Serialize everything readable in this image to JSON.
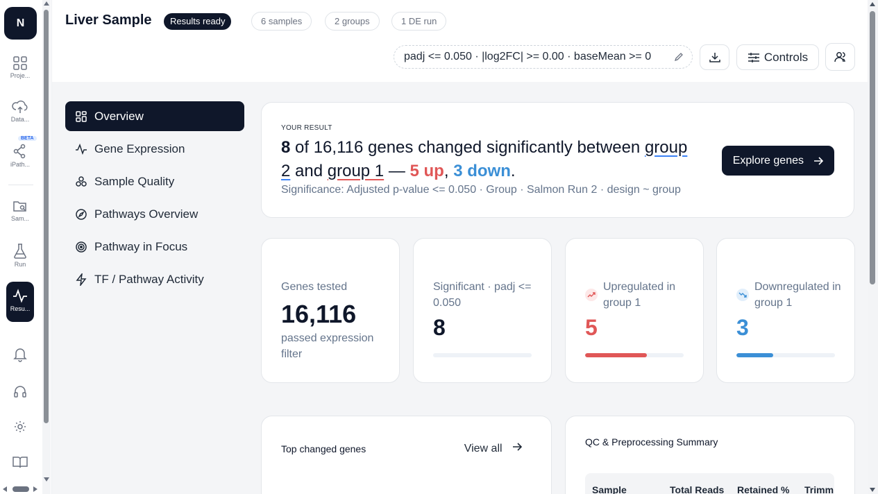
{
  "rail": {
    "logo": "N",
    "beta_badge": "BETA",
    "items": [
      {
        "label": "Proje..."
      },
      {
        "label": "Data..."
      },
      {
        "label": "iPath..."
      },
      {
        "label": "Sam..."
      },
      {
        "label": "Run"
      },
      {
        "label": "Resu..."
      }
    ],
    "bottom_icons": [
      "bell-icon",
      "headset-icon",
      "gear-icon",
      "book-icon"
    ]
  },
  "header": {
    "title": "Liver Sample",
    "status": "Results ready",
    "pills": [
      "6 samples",
      "2 groups",
      "1 DE run"
    ],
    "filter": "padj <= 0.050 · |log2FC| >= 0.00 · baseMean >= 0",
    "controls_label": "Controls"
  },
  "nav": {
    "items": [
      {
        "label": "Overview",
        "icon": "grid-icon"
      },
      {
        "label": "Gene Expression",
        "icon": "pulse-icon"
      },
      {
        "label": "Sample Quality",
        "icon": "cluster-icon"
      },
      {
        "label": "Pathways Overview",
        "icon": "compass-icon"
      },
      {
        "label": "Pathway in Focus",
        "icon": "target-icon"
      },
      {
        "label": "TF / Pathway Activity",
        "icon": "bolt-icon"
      }
    ]
  },
  "result": {
    "eyebrow": "YOUR RESULT",
    "count": "8",
    "text_a": " of 16,116 genes changed significantly between ",
    "group_a": "group 2",
    "text_and": " and ",
    "group_b": "group 1",
    "text_dash": " — ",
    "up": "5 up",
    "comma": ", ",
    "down": "3 down",
    "period": ".",
    "significance": "Significance: Adjusted p-value <= 0.050 · Group · Salmon Run 2 · design ~ group",
    "explore_label": "Explore genes"
  },
  "stats": {
    "tested": {
      "label": "Genes tested",
      "value": "16,116",
      "sub": "passed expression filter"
    },
    "significant": {
      "label": "Significant · padj <= 0.050",
      "value": "8",
      "fraction": 0
    },
    "up": {
      "label": "Upregulated in group 1",
      "value": "5",
      "fraction": 0.625,
      "color": "#e05757"
    },
    "down": {
      "label": "Downregulated in group 1",
      "value": "3",
      "fraction": 0.375,
      "color": "#3b8fd6"
    }
  },
  "top_genes": {
    "title": "Top changed genes",
    "view_all": "View all"
  },
  "qc": {
    "title": "QC & Preprocessing Summary",
    "columns": [
      "Sample",
      "Total Reads",
      "Retained %",
      "Trimm"
    ]
  }
}
